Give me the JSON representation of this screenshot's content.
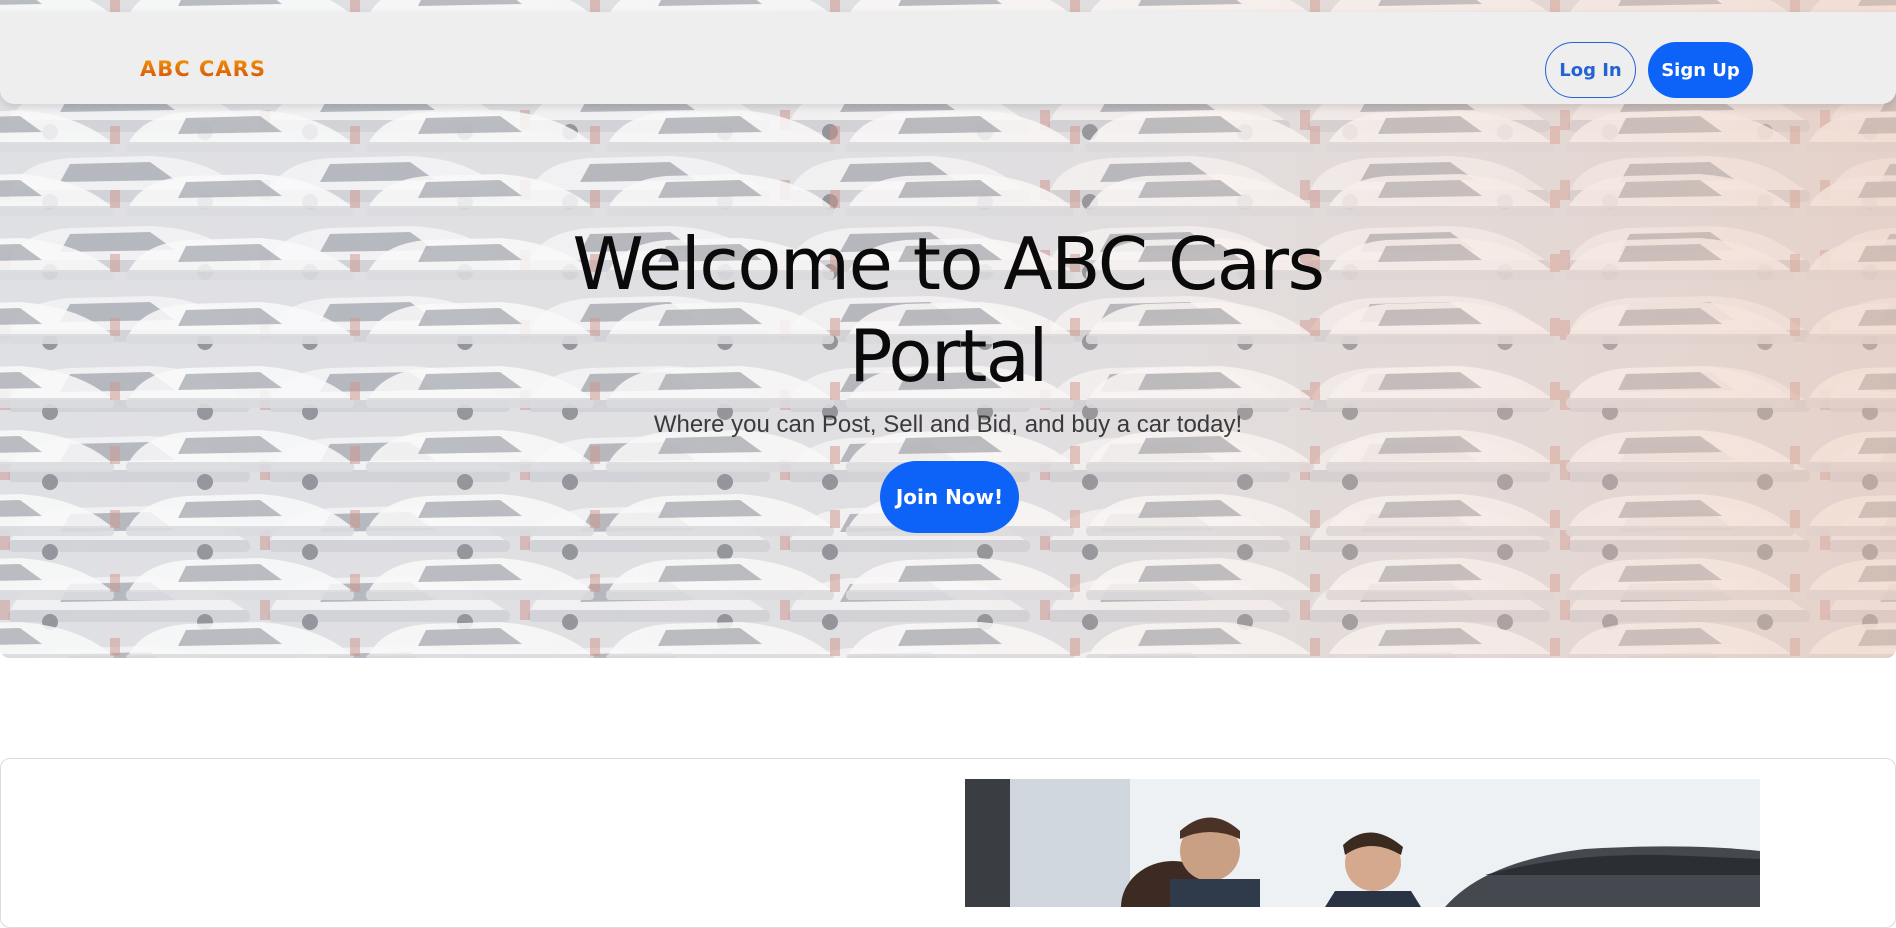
{
  "navbar": {
    "brand": "ABC CARS",
    "login_label": "Log In",
    "signup_label": "Sign Up"
  },
  "hero": {
    "title": "Welcome to ABC Cars Portal",
    "subtitle": "Where you can Post, Sell and Bid, and buy a car today!",
    "cta_label": "Join Now!",
    "background": "car-lot-photo"
  },
  "feature": {
    "image": "car-salesman-with-couple-photo"
  },
  "colors": {
    "primary": "#0d63f8",
    "brand_orange": "#e35a07",
    "navbar_bg": "#eeeeee"
  }
}
